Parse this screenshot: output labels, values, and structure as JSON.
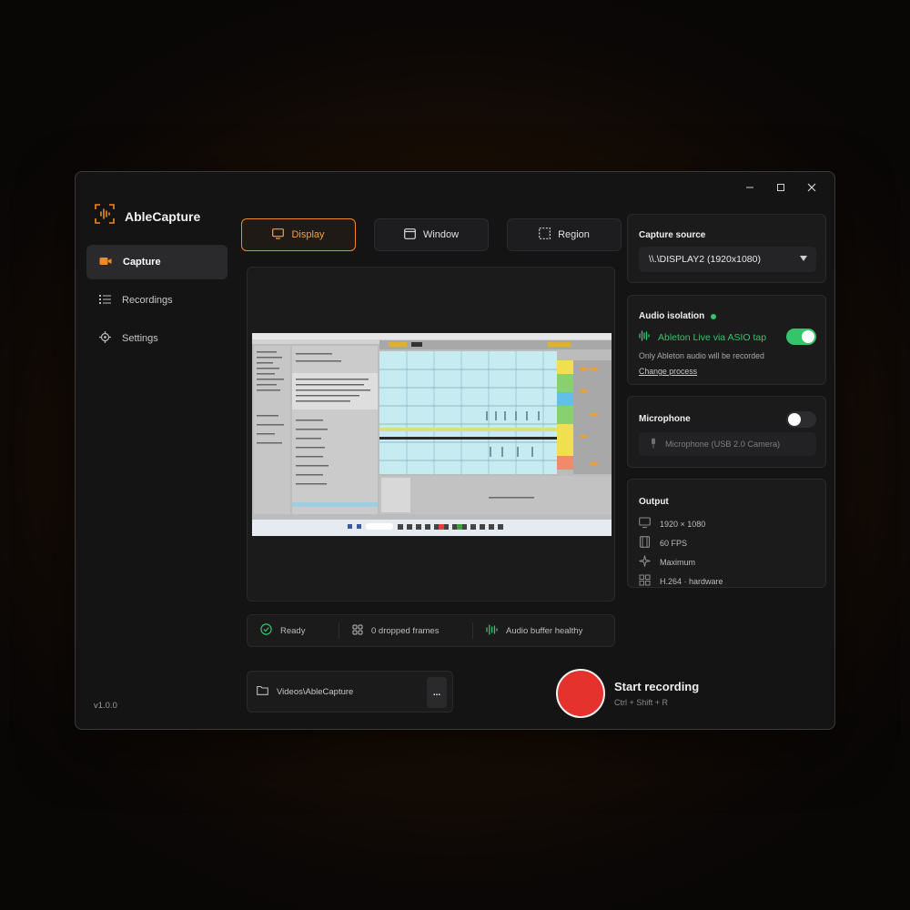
{
  "app": {
    "title": "AbleCapture",
    "version": "v1.0.0"
  },
  "colors": {
    "accent": "#f08a24",
    "record": "#e5322d",
    "success": "#36c46a"
  },
  "sidebar": {
    "items": [
      {
        "label": "Capture",
        "icon": "video-camera-icon",
        "active": true
      },
      {
        "label": "Recordings",
        "icon": "list-icon",
        "active": false
      },
      {
        "label": "Settings",
        "icon": "gear-icon",
        "active": false
      }
    ]
  },
  "tabs": [
    {
      "label": "Display",
      "icon": "monitor-icon",
      "active": true
    },
    {
      "label": "Window",
      "icon": "window-icon",
      "active": false
    },
    {
      "label": "Region",
      "icon": "region-icon",
      "active": false
    }
  ],
  "status": {
    "ready": "Ready",
    "dropped": "0 dropped frames",
    "audio": "Audio buffer healthy"
  },
  "output_folder": {
    "path": "Videos\\AbleCapture",
    "browse_label": "..."
  },
  "record": {
    "label": "Start recording",
    "shortcut": "Ctrl + Shift + R"
  },
  "capture_source": {
    "title": "Capture source",
    "value": "\\\\.\\DISPLAY2 (1920x1080)"
  },
  "audio_isolation": {
    "title": "Audio isolation",
    "source": "Ableton Live via ASIO tap",
    "note": "Only Ableton audio will be recorded",
    "change_link": "Change process",
    "enabled": true
  },
  "microphone": {
    "title": "Microphone",
    "device": "Microphone (USB 2.0 Camera)",
    "enabled": false
  },
  "output": {
    "title": "Output",
    "rows": [
      {
        "icon": "monitor-icon",
        "text": "1920 × 1080"
      },
      {
        "icon": "film-icon",
        "text": "60 FPS"
      },
      {
        "icon": "sparkle-icon",
        "text": "Maximum"
      },
      {
        "icon": "grid-icon",
        "text": "H.264 · hardware"
      }
    ]
  }
}
